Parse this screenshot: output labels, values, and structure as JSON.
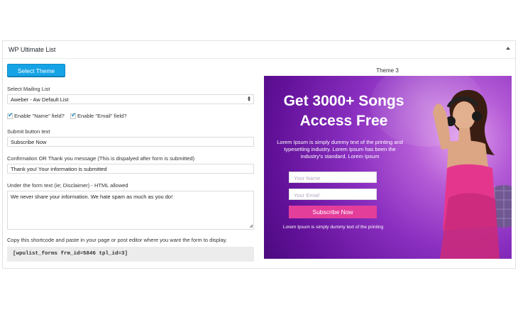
{
  "panel": {
    "title": "WP Ultimate List"
  },
  "buttons": {
    "select_theme": "Select Theme"
  },
  "mailing": {
    "label": "Select Mailing List",
    "selected": "Aweber - Aw Default List"
  },
  "checkboxes": [
    {
      "label": "Enable \"Name\" field?",
      "checked": true
    },
    {
      "label": "Enable \"Email\" field?",
      "checked": true
    }
  ],
  "submit_text": {
    "label": "Submit button text",
    "value": "Subscribe Now"
  },
  "confirmation": {
    "label": "Confirmation OR Thank you message (This is dispalyed after form is submitted)",
    "value": "Thank you! Your information is submitted"
  },
  "disclaimer": {
    "label": "Under the form text (ie; Disclaimer) - HTML allowed",
    "value": "We never share your information. We hate spam as much as you do!"
  },
  "shortcode": {
    "label": "Copy this shortcode and paste in your page or post editor where you want the form to display.",
    "value": "[wpulist_forms frm_id=5846 tpl_id=3]"
  },
  "preview": {
    "theme_label": "Theme 3",
    "heading_line1": "Get 3000+ Songs",
    "heading_line2": "Access Free",
    "description": "Lorem Ipsum is simply dummy text of the printing and typesetting industry. Lorem Ipsum has been the industry's standard. Lorem Ipsum",
    "name_placeholder": "Your Name",
    "email_placeholder": "Your Email",
    "button": "Subscribe Now",
    "footnote": "Lorem Ipsum is simply dummy text of the printing"
  },
  "colors": {
    "accent_button": "#16a3e6",
    "preview_purple": "#7a22b2",
    "subscribe_pink": "#e43e9b"
  }
}
